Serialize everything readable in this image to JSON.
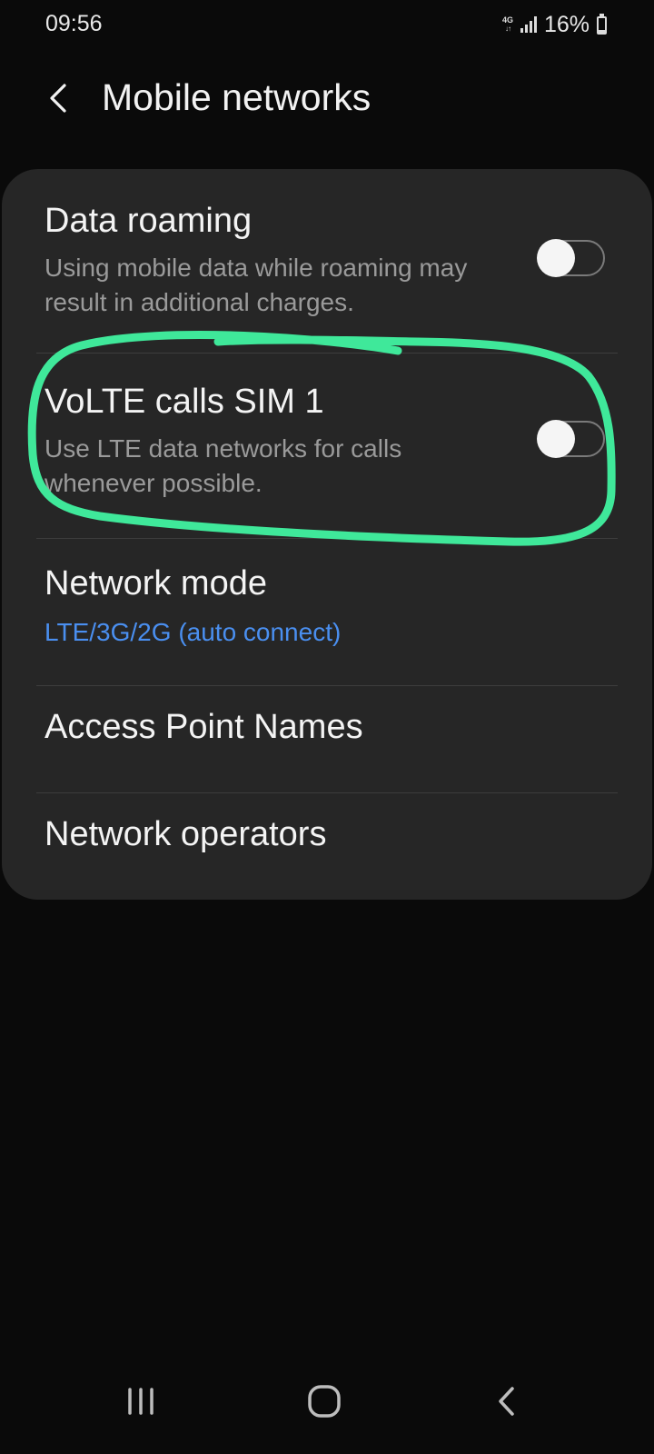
{
  "status_bar": {
    "time": "09:56",
    "network_type": "4G",
    "battery_percent": "16%",
    "battery_level": 0.16
  },
  "header": {
    "back_icon": "chevron-left-icon",
    "title": "Mobile networks"
  },
  "settings": {
    "data_roaming": {
      "title": "Data roaming",
      "subtitle": "Using mobile data while roaming may result in additional charges.",
      "enabled": false
    },
    "volte": {
      "title": "VoLTE calls SIM 1",
      "subtitle": "Use LTE data networks for calls whenever possible.",
      "enabled": false
    },
    "network_mode": {
      "title": "Network mode",
      "value": "LTE/3G/2G (auto connect)"
    },
    "access_point_names": {
      "title": "Access Point Names"
    },
    "network_operators": {
      "title": "Network operators"
    }
  },
  "annotation": {
    "color": "#3fe89a"
  },
  "colors": {
    "background": "#0a0a0a",
    "card": "#262626",
    "accent_blue": "#4a8ff0",
    "subtitle_gray": "#9a9a9a"
  },
  "nav_bar": {
    "recents_icon": "recents-icon",
    "home_icon": "home-icon",
    "back_icon": "back-icon"
  }
}
